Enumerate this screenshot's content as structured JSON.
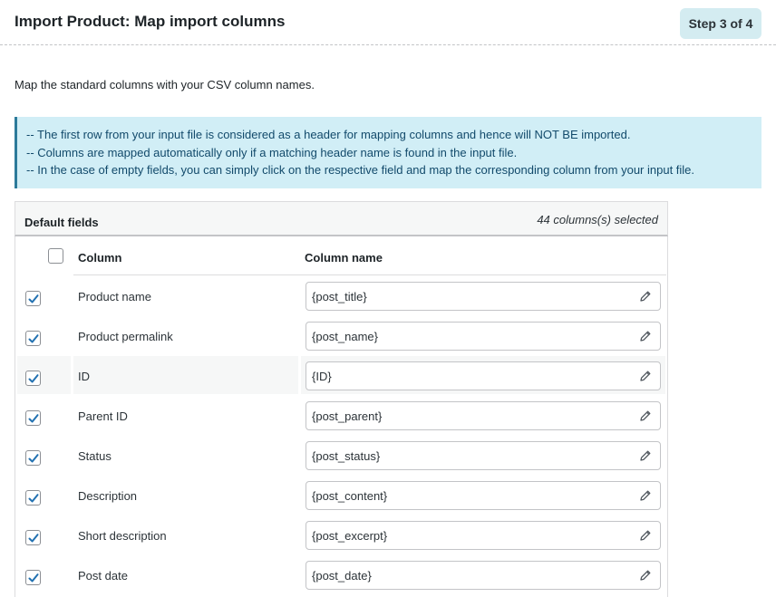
{
  "header": {
    "title": "Import Product: Map import columns",
    "step": "Step 3 of 4"
  },
  "intro": "Map the standard columns with your CSV column names.",
  "notice": {
    "lines": [
      "-- The first row from your input file is considered as a header for mapping columns and hence will NOT BE imported.",
      "-- Columns are mapped automatically only if a matching header name is found in the input file.",
      "-- In the case of empty fields, you can simply click on the respective field and map the corresponding column from your input file."
    ]
  },
  "table": {
    "section_label": "Default fields",
    "selected_count": "44 columns(s) selected",
    "col_column": "Column",
    "col_column_name": "Column name",
    "rows": [
      {
        "label": "Product name",
        "value": "{post_title}",
        "checked": true
      },
      {
        "label": "Product permalink",
        "value": "{post_name}",
        "checked": true
      },
      {
        "label": "ID",
        "value": "{ID}",
        "checked": true
      },
      {
        "label": "Parent ID",
        "value": "{post_parent}",
        "checked": true
      },
      {
        "label": "Status",
        "value": "{post_status}",
        "checked": true
      },
      {
        "label": "Description",
        "value": "{post_content}",
        "checked": true
      },
      {
        "label": "Short description",
        "value": "{post_excerpt}",
        "checked": true
      },
      {
        "label": "Post date",
        "value": "{post_date}",
        "checked": true
      }
    ]
  },
  "colors": {
    "accent": "#2271b1",
    "notice_bg": "#d1eef6",
    "notice_text": "#124a6b",
    "badge_bg": "#d4ecf1"
  },
  "icons": {
    "row_checkbox": "checkmark-icon",
    "edit": "pencil-icon"
  }
}
